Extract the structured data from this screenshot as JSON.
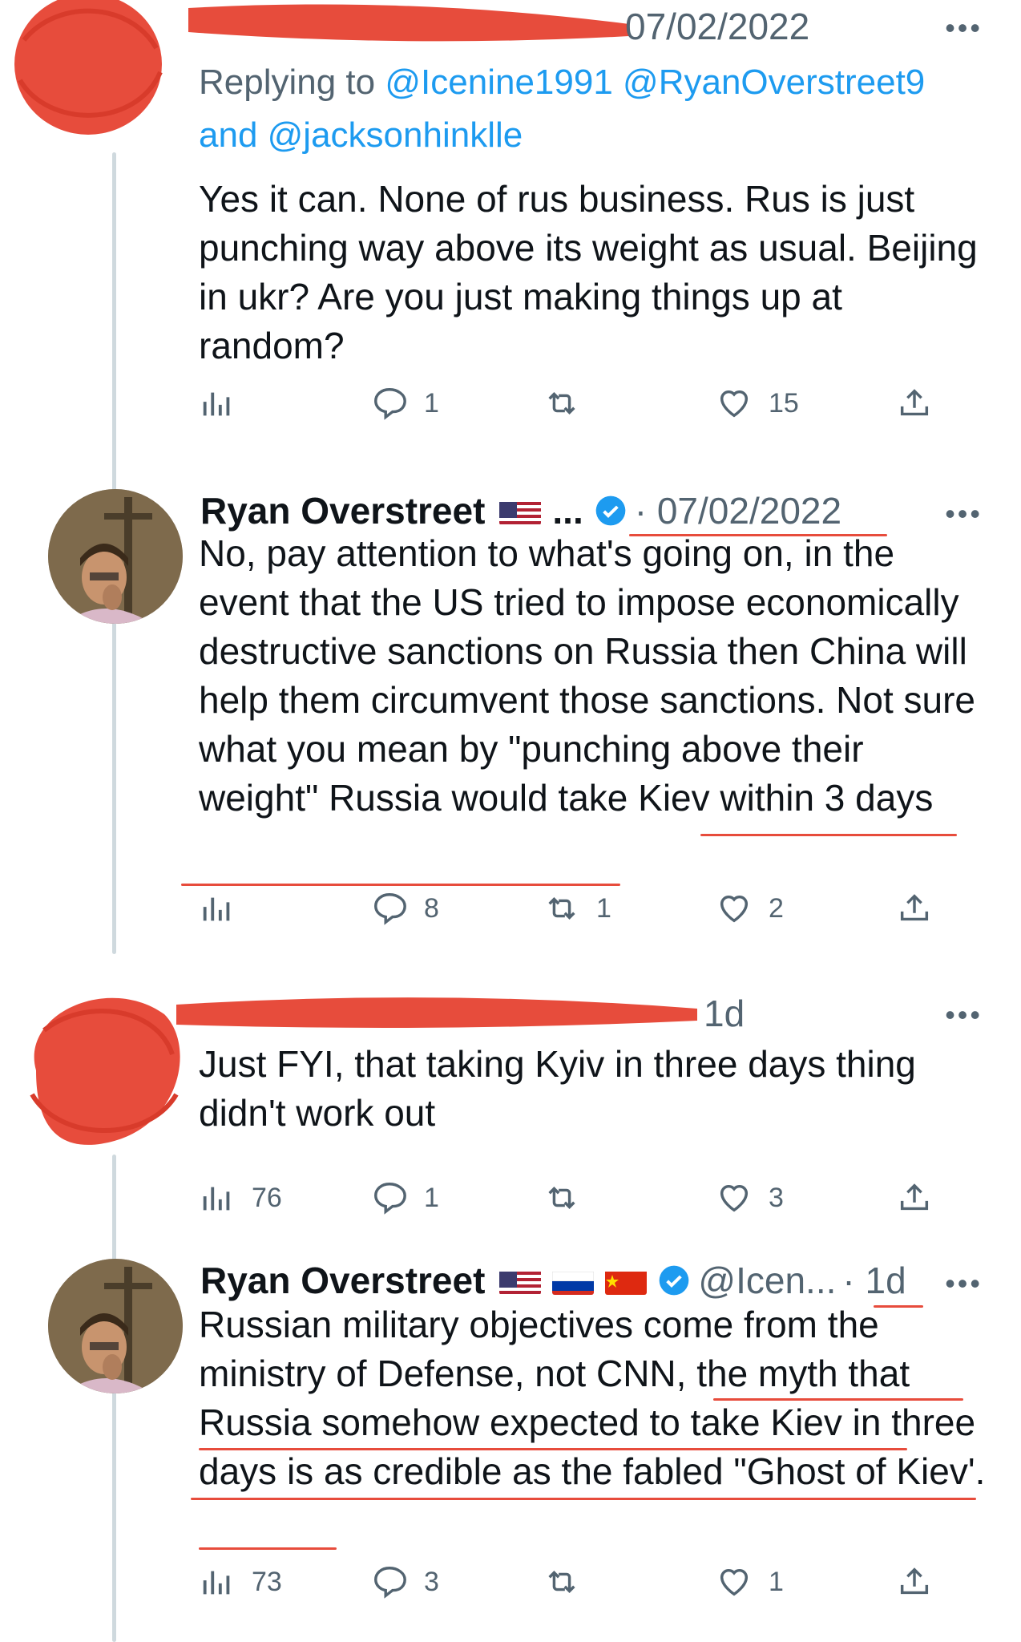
{
  "tweet1": {
    "date": "07/02/2022",
    "reply_prefix": "Replying to ",
    "mention1": "@Icenine1991",
    "mention2": "@RyanOverstreet9",
    "reply_and": "and ",
    "mention3": "@jacksonhinklle",
    "text": "Yes it can. None of rus business. Rus is just punching way above its weight as usual. Beijing in ukr? Are you just making things up at random?",
    "replies": "1",
    "retweets": "",
    "likes": "15",
    "views": ""
  },
  "tweet2": {
    "name": "Ryan Overstreet",
    "ellipsis": "...",
    "date": "· 07/02/2022",
    "text": "No, pay attention to what's going on, in the event that the US tried to impose economically destructive sanctions on Russia then China will help them circumvent those sanctions. Not sure what you mean by \"punching above their weight\" Russia would take Kiev within 3 days",
    "replies": "8",
    "retweets": "1",
    "likes": "2",
    "views": ""
  },
  "tweet3": {
    "date": "1d",
    "text": "Just FYI, that taking Kyiv in three days thing didn't work out",
    "views": "76",
    "replies": "1",
    "retweets": "",
    "likes": "3"
  },
  "tweet4": {
    "name": "Ryan Overstreet",
    "handle": "@Icen...",
    "date": "· 1d",
    "text": "Russian military objectives come from the ministry of Defense, not CNN, the myth that Russia somehow expected to take Kiev in three days is as credible as the fabled \"Ghost of Kiev'.",
    "views": "73",
    "replies": "3",
    "retweets": "",
    "likes": "1"
  },
  "more_label": "•••",
  "colors": {
    "link": "#1d9bf0",
    "muted": "#536471",
    "redaction": "#e74c3c",
    "thread": "#cfd9de"
  }
}
